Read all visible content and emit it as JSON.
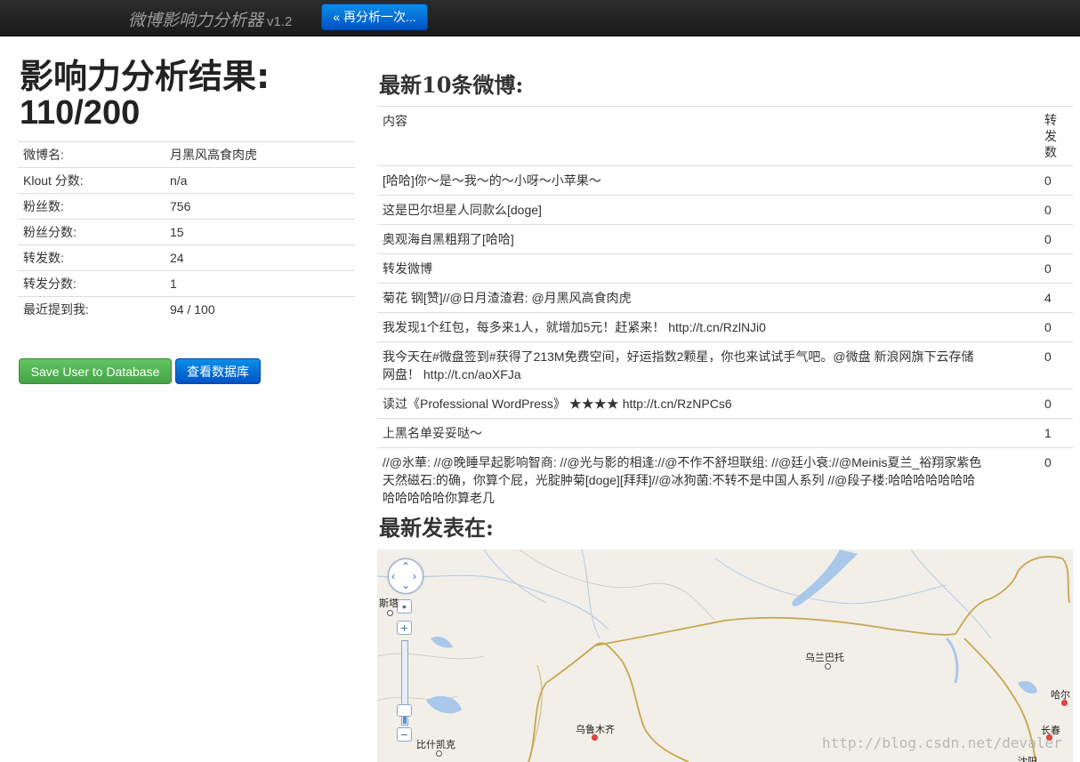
{
  "navbar": {
    "brand": "微博影响力分析器",
    "version": "v1.2",
    "reanalyze_label": "« 再分析一次..."
  },
  "result": {
    "title": "影响力分析结果:",
    "score": "110/200",
    "stats": [
      {
        "label": "微博名:",
        "value": "月黑风高食肉虎"
      },
      {
        "label": "Klout 分数:",
        "value": "n/a"
      },
      {
        "label": "粉丝数:",
        "value": "756"
      },
      {
        "label": "粉丝分数:",
        "value": "15"
      },
      {
        "label": "转发数:",
        "value": "24"
      },
      {
        "label": "转发分数:",
        "value": "1"
      },
      {
        "label": "最近提到我:",
        "value": "94 / 100"
      }
    ],
    "save_label": "Save User to Database",
    "view_db_label": "查看数据库"
  },
  "tweets": {
    "heading": "最新10条微博:",
    "col_content": "内容",
    "col_reposts": "转发数",
    "rows": [
      {
        "content": "[哈哈]你～是～我～的～小呀～小苹果～",
        "reposts": "0"
      },
      {
        "content": "这是巴尔坦星人同款么[doge]",
        "reposts": "0"
      },
      {
        "content": "奥观海自黑粗翔了[哈哈]",
        "reposts": "0"
      },
      {
        "content": "转发微博",
        "reposts": "0"
      },
      {
        "content": "菊花 钢[赞]//@日月渣渣君: @月黑风高食肉虎",
        "reposts": "4"
      },
      {
        "content": "我发现1个红包，每多来1人，就增加5元！赶紧来！ http://t.cn/RzlNJi0",
        "reposts": "0"
      },
      {
        "content": "我今天在#微盘签到#获得了213M免费空间，好运指数2颗星，你也来试试手气吧。@微盘 新浪网旗下云存储网盘！ http://t.cn/aoXFJa",
        "reposts": "0"
      },
      {
        "content": "读过《Professional WordPress》 ★★★★ http://t.cn/RzNPCs6",
        "reposts": "0"
      },
      {
        "content": "上黑名单妥妥哒～",
        "reposts": "1"
      },
      {
        "content": "//@氷華: //@晚睡早起影响智商: //@光与影的相逢://@不作不舒坦联组: //@廷小衰://@Meinis夏兰_裕翔家紫色天然磁石:的确，你算个屁，光腚肿菊[doge][拜拜]//@冰狗菌:不转不是中国人系列 //@段子楼:哈哈哈哈哈哈哈哈哈哈哈哈你算老几",
        "reposts": "0"
      }
    ]
  },
  "map": {
    "heading": "最新发表在:",
    "cities": {
      "astana": "斯塔",
      "ulaanbaatar": "乌兰巴托",
      "urumqi": "乌鲁木齐",
      "kashgar": "比什凯克",
      "harbin": "哈尔",
      "changchun": "长春",
      "shenyang": "沈阳"
    },
    "zoom_in": "+",
    "zoom_out": "−",
    "watermark": "http://blog.csdn.net/devaler",
    "colors": {
      "land": "#f2efe9",
      "water": "#a9c8ea",
      "border": "#c8a650",
      "river": "#b5cbe6"
    }
  }
}
